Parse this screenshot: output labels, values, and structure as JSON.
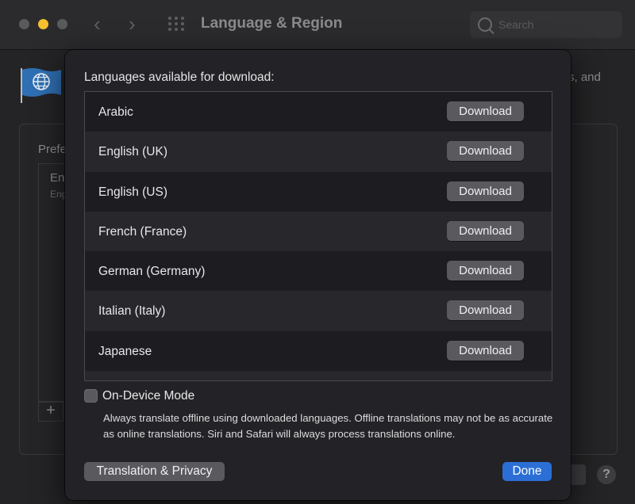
{
  "window": {
    "title": "Language & Region",
    "search_placeholder": "Search",
    "icons": [
      "back-icon",
      "forward-icon",
      "grid-icon",
      "search-icon",
      "globe-flag-icon",
      "help-icon"
    ],
    "nav_back_glyph": "‹",
    "nav_forward_glyph": "›"
  },
  "background": {
    "header_tail": "s, and",
    "preferred_label_partial": "Prefe",
    "list_item_primary_partial": "En",
    "list_item_secondary_partial": "Eng",
    "add_glyph": "+",
    "help_glyph": "?"
  },
  "sheet": {
    "heading": "Languages available for download:",
    "languages": [
      {
        "name": "Arabic",
        "action": "Download"
      },
      {
        "name": "English (UK)",
        "action": "Download"
      },
      {
        "name": "English (US)",
        "action": "Download"
      },
      {
        "name": "French (France)",
        "action": "Download"
      },
      {
        "name": "German (Germany)",
        "action": "Download"
      },
      {
        "name": "Italian (Italy)",
        "action": "Download"
      },
      {
        "name": "Japanese",
        "action": "Download"
      }
    ],
    "on_device_mode": {
      "label": "On-Device Mode",
      "checked": false,
      "description": "Always translate offline using downloaded languages. Offline translations may not be as accurate as online translations. Siri and Safari will always process translations online."
    },
    "privacy_button": "Translation & Privacy",
    "done_button": "Done"
  },
  "colors": {
    "accent": "#2b6fd6",
    "traffic_minimize": "#f5bf2f",
    "sheet_background": "#232226"
  }
}
